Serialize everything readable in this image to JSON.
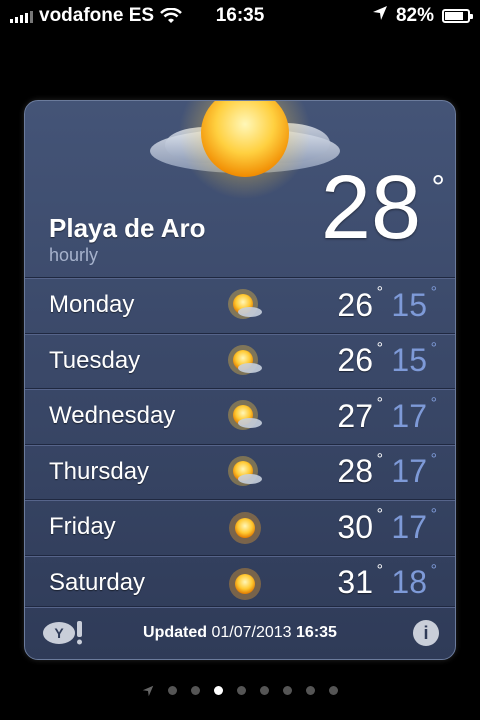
{
  "status_bar": {
    "carrier": "vodafone ES",
    "time": "16:35",
    "battery": "82%",
    "battery_level": 0.82
  },
  "card": {
    "city": "Playa de Aro",
    "subtitle": "hourly",
    "current_temp": "28",
    "degree_symbol": "°",
    "forecast": [
      {
        "day": "Monday",
        "icon": "sun-cloud-icon",
        "high": "26",
        "low": "15"
      },
      {
        "day": "Tuesday",
        "icon": "sun-cloud-icon",
        "high": "26",
        "low": "15"
      },
      {
        "day": "Wednesday",
        "icon": "sun-cloud-icon",
        "high": "27",
        "low": "17"
      },
      {
        "day": "Thursday",
        "icon": "sun-cloud-icon",
        "high": "28",
        "low": "17"
      },
      {
        "day": "Friday",
        "icon": "sun-icon",
        "high": "30",
        "low": "17"
      },
      {
        "day": "Saturday",
        "icon": "sun-icon",
        "high": "31",
        "low": "18"
      }
    ],
    "footer": {
      "updated_label": "Updated",
      "updated_date": "01/07/2013",
      "updated_time": "16:35",
      "info_label": "i"
    }
  },
  "colors": {
    "card_top": "#445477",
    "card_bottom": "#2f3b58",
    "low_temp": "#7e9ad8",
    "subtitle": "#a6b2cc"
  },
  "pager": {
    "pages": 9,
    "active_index": 3
  }
}
